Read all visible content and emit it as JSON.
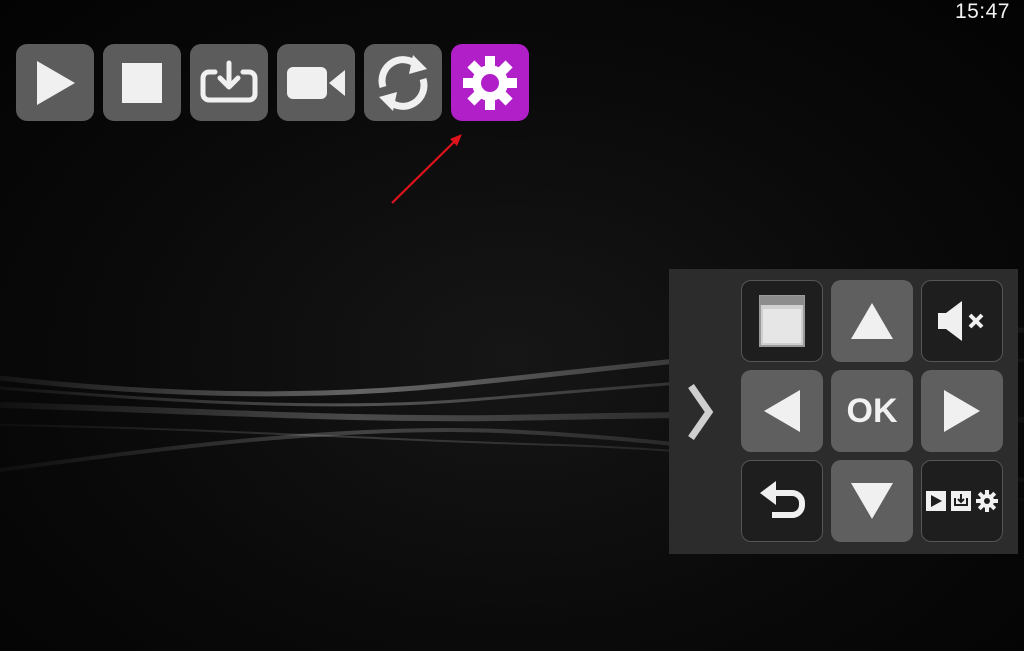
{
  "status_bar": {
    "time": "15:47"
  },
  "toolbar": {
    "buttons": [
      {
        "id": "play",
        "icon": "play-icon",
        "active": false
      },
      {
        "id": "stop",
        "icon": "stop-icon",
        "active": false
      },
      {
        "id": "install",
        "icon": "install-tray-icon",
        "active": false
      },
      {
        "id": "record",
        "icon": "video-camera-icon",
        "active": false
      },
      {
        "id": "refresh",
        "icon": "refresh-icon",
        "active": false
      },
      {
        "id": "settings",
        "icon": "gear-icon",
        "active": true
      }
    ],
    "active_color": "#b01fc8"
  },
  "annotation": {
    "type": "arrow",
    "color": "#e0121b",
    "points_to": "settings"
  },
  "remote_panel": {
    "collapse_icon": "chevron-right-icon",
    "ok_label": "OK",
    "buttons": [
      {
        "id": "menu",
        "icon": "window-icon"
      },
      {
        "id": "up",
        "icon": "arrow-up-icon"
      },
      {
        "id": "mute",
        "icon": "mute-icon"
      },
      {
        "id": "left",
        "icon": "arrow-left-icon"
      },
      {
        "id": "ok",
        "icon": "ok-text"
      },
      {
        "id": "right",
        "icon": "arrow-right-icon"
      },
      {
        "id": "back",
        "icon": "back-arrow-icon"
      },
      {
        "id": "down",
        "icon": "arrow-down-icon"
      },
      {
        "id": "toolbar-toggle",
        "icon": "mini-toolbar-icon"
      }
    ]
  }
}
